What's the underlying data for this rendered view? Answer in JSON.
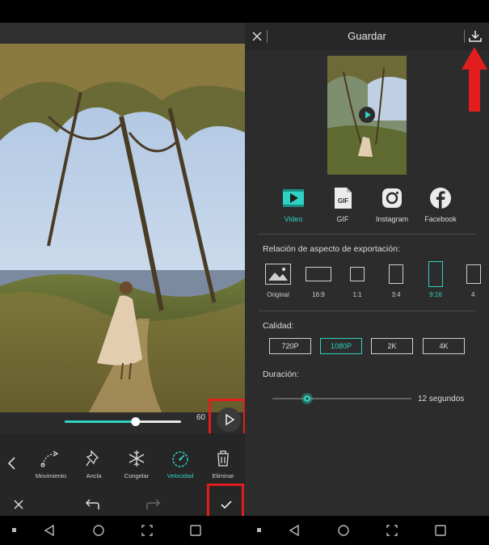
{
  "editor": {
    "time_label": "60",
    "tools": [
      {
        "label": "Movimiento",
        "icon": "motion-path-icon"
      },
      {
        "label": "Ancla",
        "icon": "pin-icon"
      },
      {
        "label": "Congelar",
        "icon": "snowflake-icon"
      },
      {
        "label": "Velocidad",
        "icon": "speedometer-icon"
      },
      {
        "label": "Eliminar",
        "icon": "trash-icon"
      }
    ],
    "active_tool": "Velocidad",
    "seek_progress": 0.61
  },
  "save_screen": {
    "title": "Guardar",
    "formats": [
      {
        "label": "Video",
        "icon": "video-play-icon"
      },
      {
        "label": "GIF",
        "icon": "gif-file-icon"
      },
      {
        "label": "Instagram",
        "icon": "instagram-icon"
      },
      {
        "label": "Facebook",
        "icon": "facebook-icon"
      }
    ],
    "active_format": "Video",
    "aspect_section_label": "Relación de aspecto de exportación:",
    "aspect_ratios": [
      "Original",
      "16:9",
      "1:1",
      "3:4",
      "9:16",
      "4"
    ],
    "active_aspect": "9:16",
    "quality_section_label": "Calidad:",
    "quality_options": [
      "720P",
      "1080P",
      "2K",
      "4K"
    ],
    "active_quality": "1080P",
    "duration_section_label": "Duración:",
    "duration_value": "12 segundos",
    "duration_progress": 0.25
  },
  "colors": {
    "accent": "#2fd1c2",
    "highlight": "#e21d1d"
  }
}
